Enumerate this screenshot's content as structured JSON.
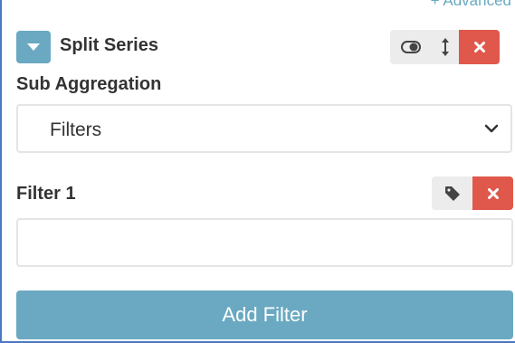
{
  "header": {
    "advanced_link": "+ Advanced",
    "series_title": "Split Series",
    "buttons": {
      "toggle_icon": "toggle-switch-icon",
      "move_icon": "vertical-resize-icon",
      "remove_icon": "close-icon"
    }
  },
  "sub_aggregation": {
    "label": "Sub Aggregation",
    "selected": "Filters"
  },
  "filter1": {
    "label": "Filter 1",
    "value": "",
    "tag_icon": "tag-icon",
    "remove_icon": "close-icon"
  },
  "add_filter": {
    "label": "Add Filter"
  },
  "colors": {
    "accent": "#6aa9c1",
    "danger": "#e0584b",
    "frame_border": "#4a78c2"
  }
}
